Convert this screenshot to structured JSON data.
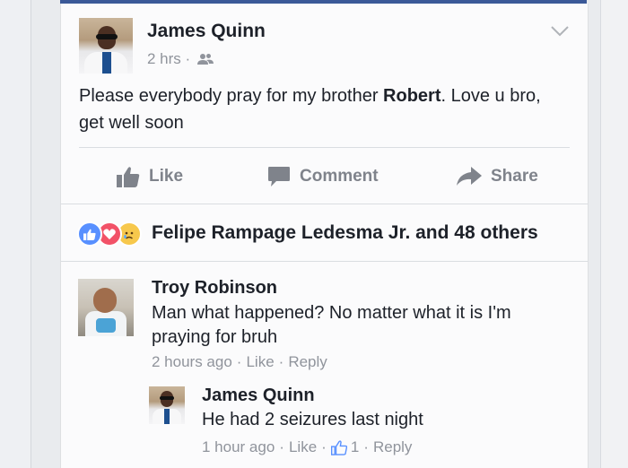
{
  "post": {
    "author": "James Quinn",
    "time": "2 hrs",
    "meta_separator": "·",
    "text_before": "Please everybody pray for my brother ",
    "text_bold": "Robert",
    "text_after": ". Love u bro, get well soon"
  },
  "actions": {
    "like": "Like",
    "comment": "Comment",
    "share": "Share"
  },
  "reactions": {
    "types": [
      "like",
      "love",
      "sad"
    ],
    "summary": "Felipe Rampage Ledesma Jr. and 48 others"
  },
  "comments": [
    {
      "author": "Troy Robinson",
      "text": "Man what happened? No matter what it is I'm praying for bruh",
      "time": "2 hours ago",
      "like_label": "Like",
      "reply_label": "Reply"
    }
  ],
  "reply": {
    "author": "James Quinn",
    "text": "He had 2 seizures last night",
    "time": "1 hour ago",
    "like_label": "Like",
    "like_count": "1",
    "reply_label": "Reply"
  },
  "colors": {
    "brand": "#3b5998",
    "text": "#1d2129",
    "muted": "#90949c",
    "like_reaction": "#5890ff",
    "love_reaction": "#f25268",
    "sad_reaction": "#f7c84c"
  }
}
